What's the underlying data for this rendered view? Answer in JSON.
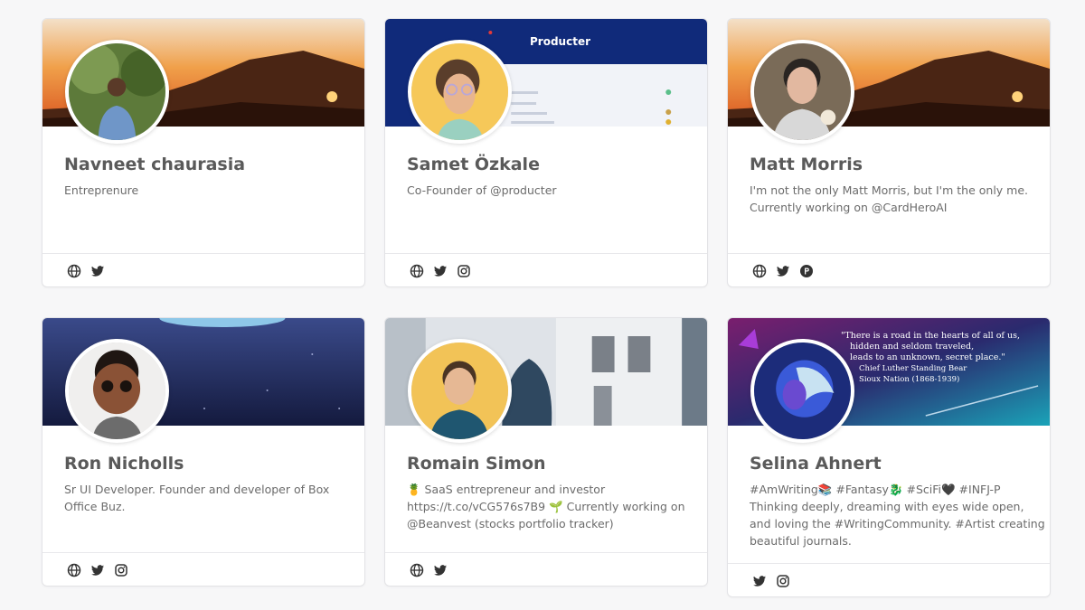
{
  "profiles": [
    {
      "name": "Navneet chaurasia",
      "bio": [
        "Entreprenure"
      ],
      "links": [
        "globe-icon",
        "twitter-icon"
      ]
    },
    {
      "name": "Samet Özkale",
      "bio": [
        "Co-Founder of @producter"
      ],
      "banner_text": "Producter",
      "links": [
        "globe-icon",
        "twitter-icon",
        "instagram-icon"
      ]
    },
    {
      "name": "Matt Morris",
      "bio": [
        "I'm not the only Matt Morris, but I'm the only me.",
        "Currently working on @CardHeroAI"
      ],
      "links": [
        "globe-icon",
        "twitter-icon",
        "producthunt-icon"
      ]
    },
    {
      "name": "Ron Nicholls",
      "bio": [
        "Sr UI Developer. Founder and developer of Box",
        "Office Buz."
      ],
      "links": [
        "globe-icon",
        "twitter-icon",
        "instagram-icon"
      ]
    },
    {
      "name": "Romain Simon",
      "bio": [
        "🍍 SaaS entrepreneur and investor",
        "https://t.co/vCG576s7B9 🌱 Currently working on",
        "@Beanvest (stocks portfolio tracker)"
      ],
      "links": [
        "globe-icon",
        "twitter-icon"
      ]
    },
    {
      "name": "Selina Ahnert",
      "bio": [
        "#AmWriting📚 #Fantasy🐉 #SciFi🖤 #INFJ-P",
        "Thinking deeply, dreaming with eyes wide open,",
        "and loving the #WritingCommunity. #Artist creating",
        "beautiful journals."
      ],
      "banner_quote": [
        "\"There is a road in the hearts of all of us,",
        "hidden and seldom traveled,",
        "leads to an unknown, secret place.\"",
        "Chief Luther Standing Bear",
        "Sioux Nation (1868-1939)"
      ],
      "links": [
        "twitter-icon",
        "instagram-icon"
      ]
    }
  ],
  "colors": {
    "icon": "#333333",
    "name": "#5a5a5a",
    "bio": "#6b6b6b",
    "border": "#e3e3e6"
  }
}
